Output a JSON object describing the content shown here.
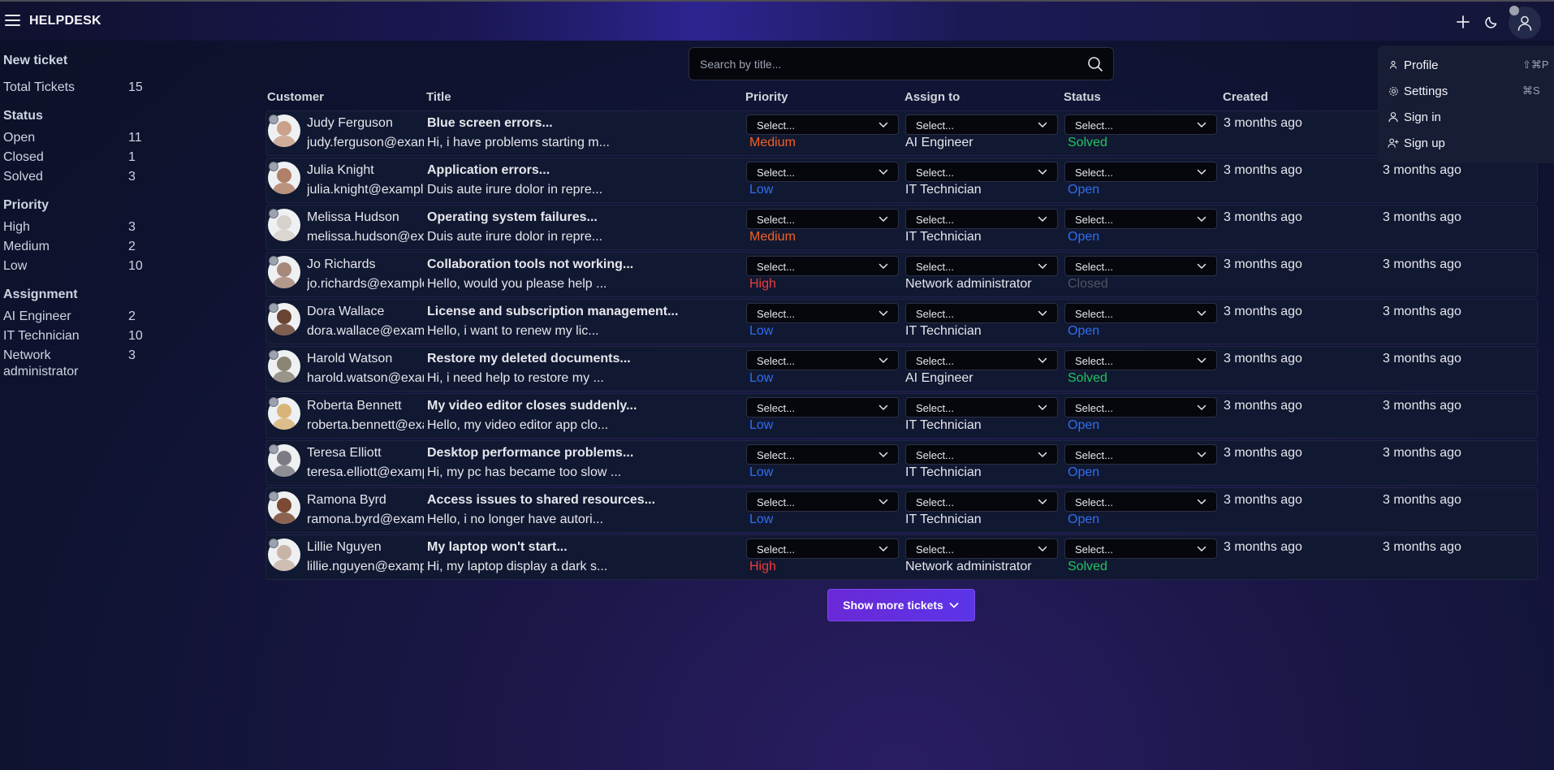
{
  "app": {
    "brand": "HELPDESK"
  },
  "search": {
    "placeholder": "Search by title..."
  },
  "sidebar": {
    "new_ticket": "New ticket",
    "total": {
      "label": "Total Tickets",
      "value": "15"
    },
    "status": {
      "heading": "Status",
      "items": [
        {
          "label": "Open",
          "value": "11"
        },
        {
          "label": "Closed",
          "value": "1"
        },
        {
          "label": "Solved",
          "value": "3"
        }
      ]
    },
    "priority": {
      "heading": "Priority",
      "items": [
        {
          "label": "High",
          "value": "3"
        },
        {
          "label": "Medium",
          "value": "2"
        },
        {
          "label": "Low",
          "value": "10"
        }
      ]
    },
    "assignment": {
      "heading": "Assignment",
      "items": [
        {
          "label": "AI Engineer",
          "value": "2"
        },
        {
          "label": "IT Technician",
          "value": "10"
        },
        {
          "label": "Network administrator",
          "value": "3"
        }
      ]
    }
  },
  "table": {
    "headers": {
      "customer": "Customer",
      "title": "Title",
      "priority": "Priority",
      "assign": "Assign to",
      "status": "Status",
      "created": "Created"
    },
    "select_placeholder": "Select...",
    "rows": [
      {
        "name": "Judy Ferguson",
        "email": "judy.ferguson@example.com",
        "title": "Blue screen errors...",
        "desc": "Hi, i have problems starting m...",
        "priority": "Medium",
        "assign": "AI Engineer",
        "status": "Solved",
        "created": "3 months ago",
        "updated": "",
        "avatar_color": "#caa189"
      },
      {
        "name": "Julia Knight",
        "email": "julia.knight@example.com",
        "title": "Application errors...",
        "desc": "Duis aute irure dolor in repre...",
        "priority": "Low",
        "assign": "IT Technician",
        "status": "Open",
        "created": "3 months ago",
        "updated": "3 months ago",
        "avatar_color": "#b08068"
      },
      {
        "name": "Melissa Hudson",
        "email": "melissa.hudson@example.com",
        "title": "Operating system failures...",
        "desc": "Duis aute irure dolor in repre...",
        "priority": "Medium",
        "assign": "IT Technician",
        "status": "Open",
        "created": "3 months ago",
        "updated": "3 months ago",
        "avatar_color": "#d7d1cc"
      },
      {
        "name": "Jo Richards",
        "email": "jo.richards@example.com",
        "title": "Collaboration tools not working...",
        "desc": "Hello, would you please help ...",
        "priority": "High",
        "assign": "Network administrator",
        "status": "Closed",
        "created": "3 months ago",
        "updated": "3 months ago",
        "avatar_color": "#a7897c"
      },
      {
        "name": "Dora Wallace",
        "email": "dora.wallace@example.com",
        "title": "License and subscription management...",
        "desc": "Hello, i want to renew my lic...",
        "priority": "Low",
        "assign": "IT Technician",
        "status": "Open",
        "created": "3 months ago",
        "updated": "3 months ago",
        "avatar_color": "#6b4434"
      },
      {
        "name": "Harold Watson",
        "email": "harold.watson@example.com",
        "title": "Restore my deleted documents...",
        "desc": "Hi, i need help to restore my ...",
        "priority": "Low",
        "assign": "AI Engineer",
        "status": "Solved",
        "created": "3 months ago",
        "updated": "3 months ago",
        "avatar_color": "#8b8576"
      },
      {
        "name": "Roberta Bennett",
        "email": "roberta.bennett@example.com",
        "title": "My video editor closes suddenly...",
        "desc": "Hello, my video editor app clo...",
        "priority": "Low",
        "assign": "IT Technician",
        "status": "Open",
        "created": "3 months ago",
        "updated": "3 months ago",
        "avatar_color": "#d9b47a"
      },
      {
        "name": "Teresa Elliott",
        "email": "teresa.elliott@example.com",
        "title": "Desktop performance problems...",
        "desc": "Hi, my pc has became too slow ...",
        "priority": "Low",
        "assign": "IT Technician",
        "status": "Open",
        "created": "3 months ago",
        "updated": "3 months ago",
        "avatar_color": "#7d7c84"
      },
      {
        "name": "Ramona Byrd",
        "email": "ramona.byrd@example.com",
        "title": "Access issues to shared resources...",
        "desc": "Hello, i no longer have autori...",
        "priority": "Low",
        "assign": "IT Technician",
        "status": "Open",
        "created": "3 months ago",
        "updated": "3 months ago",
        "avatar_color": "#7a4a35"
      },
      {
        "name": "Lillie Nguyen",
        "email": "lillie.nguyen@example.com",
        "title": "My laptop won't start...",
        "desc": "Hi, my laptop display a dark s...",
        "priority": "High",
        "assign": "Network administrator",
        "status": "Solved",
        "created": "3 months ago",
        "updated": "3 months ago",
        "avatar_color": "#c9b5a7"
      }
    ]
  },
  "show_more": {
    "label": "Show more tickets"
  },
  "user_menu": {
    "items": [
      {
        "label": "Profile",
        "shortcut": "⇧⌘P",
        "icon": "person-icon"
      },
      {
        "label": "Settings",
        "shortcut": "⌘S",
        "icon": "gear-icon"
      },
      {
        "label": "Sign in",
        "shortcut": "",
        "icon": "user-icon"
      },
      {
        "label": "Sign up",
        "shortcut": "",
        "icon": "user-plus-icon"
      }
    ]
  },
  "colors": {
    "priority": {
      "High": "#ef3b3b",
      "Medium": "#f4611f",
      "Low": "#2f6ff0"
    },
    "status": {
      "Open": "#2f6ff0",
      "Solved": "#22c55e",
      "Closed": "#4b5563"
    }
  }
}
